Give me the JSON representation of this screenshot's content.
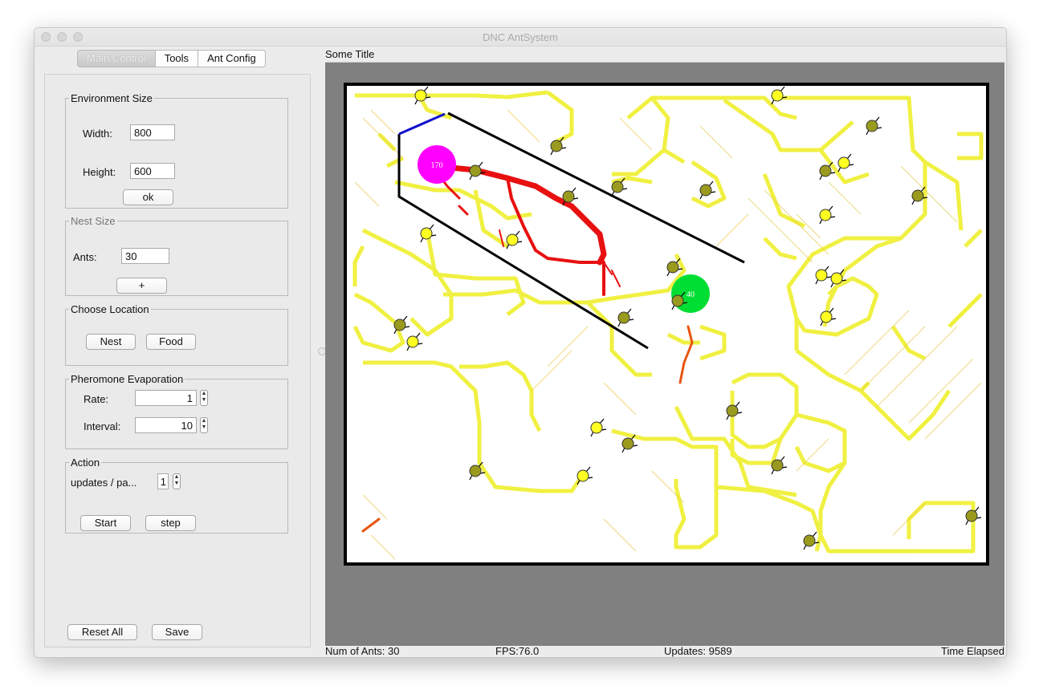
{
  "window": {
    "title": "DNC AntSystem"
  },
  "tabs": [
    {
      "label": "Main Control",
      "active": true
    },
    {
      "label": "Tools",
      "active": false
    },
    {
      "label": "Ant Config",
      "active": false
    }
  ],
  "env_size": {
    "legend": "Environment Size",
    "width_label": "Width:",
    "width_value": "800",
    "height_label": "Height:",
    "height_value": "600",
    "ok_label": "ok"
  },
  "nest_size": {
    "legend": "Nest Size",
    "ants_label": "Ants:",
    "ants_value": "30",
    "plus_label": "+"
  },
  "location": {
    "legend": "Choose Location",
    "nest_label": "Nest",
    "food_label": "Food"
  },
  "evaporation": {
    "legend": "Pheromone Evaporation",
    "rate_label": "Rate:",
    "rate_value": "1",
    "interval_label": "Interval:",
    "interval_value": "10"
  },
  "action": {
    "legend": "Action",
    "updates_label": "updates / pa...",
    "updates_value": "1",
    "start_label": "Start",
    "step_label": "step"
  },
  "bottom_buttons": {
    "reset_label": "Reset All",
    "save_label": "Save"
  },
  "canvas": {
    "title": "Some Title",
    "nest_count": "170",
    "food_count": "40",
    "colors": {
      "nest": "#ff00ff",
      "food": "#00dd00",
      "ant_searching": "#ffff22",
      "ant_returning": "#9a9a1e",
      "trail_weak": "#f0f000",
      "trail_strong": "#e81010",
      "wall": "#000000",
      "wall_blue": "#1010cc"
    }
  },
  "status": {
    "num_ants": "Num of Ants: 30",
    "fps": "FPS:76.0",
    "updates": "Updates: 9589",
    "time": "Time Elapsed"
  }
}
